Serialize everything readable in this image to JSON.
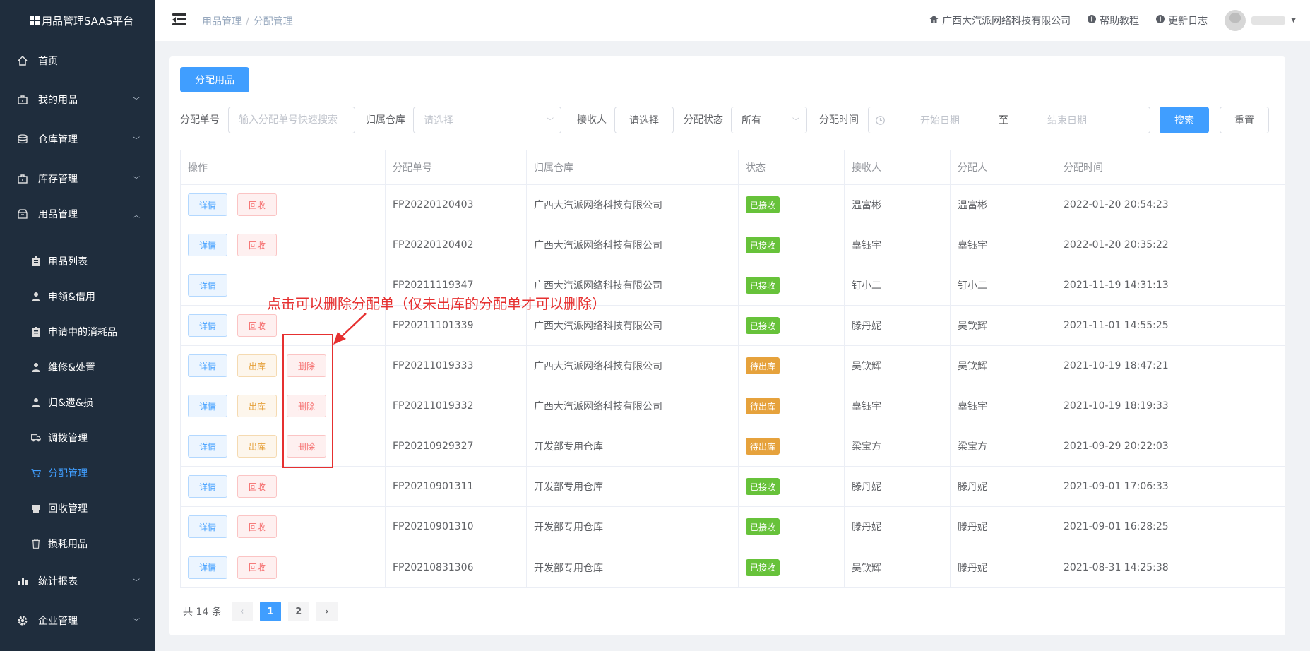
{
  "brand": {
    "title": "用品管理SAAS平台"
  },
  "sidebar": {
    "items": [
      {
        "label": "首页",
        "icon": "home-icon"
      },
      {
        "label": "我的用品",
        "icon": "bag-icon",
        "chevron": "down"
      },
      {
        "label": "仓库管理",
        "icon": "database-icon",
        "chevron": "down"
      },
      {
        "label": "库存管理",
        "icon": "bag-icon",
        "chevron": "down"
      },
      {
        "label": "用品管理",
        "icon": "box-icon",
        "chevron": "up"
      },
      {
        "label": "统计报表",
        "icon": "chart-icon",
        "chevron": "down"
      },
      {
        "label": "企业管理",
        "icon": "gear-icon",
        "chevron": "down"
      }
    ],
    "submenu": [
      {
        "label": "用品列表",
        "icon": "clipboard-icon"
      },
      {
        "label": "申领&借用",
        "icon": "user-icon"
      },
      {
        "label": "申请中的消耗品",
        "icon": "clipboard-icon"
      },
      {
        "label": "维修&处置",
        "icon": "user-icon"
      },
      {
        "label": "归&遗&损",
        "icon": "user-icon"
      },
      {
        "label": "调拨管理",
        "icon": "truck-icon"
      },
      {
        "label": "分配管理",
        "icon": "cart-icon",
        "active": true
      },
      {
        "label": "回收管理",
        "icon": "printer-icon"
      },
      {
        "label": "损耗用品",
        "icon": "trash-icon"
      }
    ]
  },
  "header": {
    "breadcrumb": [
      "用品管理",
      "分配管理"
    ],
    "company": "广西大汽派网络科技有限公司",
    "help": "帮助教程",
    "changelog": "更新日志"
  },
  "toolbar": {
    "assign_button": "分配用品"
  },
  "filters": {
    "no_label": "分配单号",
    "no_placeholder": "输入分配单号快速搜索",
    "warehouse_label": "归属仓库",
    "warehouse_placeholder": "请选择",
    "receiver_label": "接收人",
    "receiver_button": "请选择",
    "status_label": "分配状态",
    "status_value": "所有",
    "time_label": "分配时间",
    "start_placeholder": "开始日期",
    "range_sep": "至",
    "end_placeholder": "结束日期",
    "search_button": "搜索",
    "reset_button": "重置"
  },
  "table": {
    "columns": [
      "操作",
      "分配单号",
      "归属仓库",
      "状态",
      "接收人",
      "分配人",
      "分配时间"
    ],
    "rows": [
      {
        "actions": [
          "详情",
          "回收"
        ],
        "no": "FP20220120403",
        "warehouse": "广西大汽派网络科技有限公司",
        "status": "已接收",
        "receiver": "温富彬",
        "assigner": "温富彬",
        "time": "2022-01-20 20:54:23"
      },
      {
        "actions": [
          "详情",
          "回收"
        ],
        "no": "FP20220120402",
        "warehouse": "广西大汽派网络科技有限公司",
        "status": "已接收",
        "receiver": "辜钰宇",
        "assigner": "辜钰宇",
        "time": "2022-01-20 20:35:22"
      },
      {
        "actions": [
          "详情"
        ],
        "no": "FP20211119347",
        "warehouse": "广西大汽派网络科技有限公司",
        "status": "已接收",
        "receiver": "钉小二",
        "assigner": "钉小二",
        "time": "2021-11-19 14:31:13"
      },
      {
        "actions": [
          "详情",
          "回收"
        ],
        "no": "FP20211101339",
        "warehouse": "广西大汽派网络科技有限公司",
        "status": "已接收",
        "receiver": "滕丹妮",
        "assigner": "吴钦辉",
        "time": "2021-11-01 14:55:25"
      },
      {
        "actions": [
          "详情",
          "出库",
          "删除"
        ],
        "no": "FP20211019333",
        "warehouse": "广西大汽派网络科技有限公司",
        "status": "待出库",
        "receiver": "吴钦辉",
        "assigner": "吴钦辉",
        "time": "2021-10-19 18:47:21"
      },
      {
        "actions": [
          "详情",
          "出库",
          "删除"
        ],
        "no": "FP20211019332",
        "warehouse": "广西大汽派网络科技有限公司",
        "status": "待出库",
        "receiver": "辜钰宇",
        "assigner": "辜钰宇",
        "time": "2021-10-19 18:19:33"
      },
      {
        "actions": [
          "详情",
          "出库",
          "删除"
        ],
        "no": "FP20210929327",
        "warehouse": "开发部专用仓库",
        "status": "待出库",
        "receiver": "梁宝方",
        "assigner": "梁宝方",
        "time": "2021-09-29 20:22:03"
      },
      {
        "actions": [
          "详情",
          "回收"
        ],
        "no": "FP20210901311",
        "warehouse": "开发部专用仓库",
        "status": "已接收",
        "receiver": "滕丹妮",
        "assigner": "滕丹妮",
        "time": "2021-09-01 17:06:33"
      },
      {
        "actions": [
          "详情",
          "回收"
        ],
        "no": "FP20210901310",
        "warehouse": "开发部专用仓库",
        "status": "已接收",
        "receiver": "滕丹妮",
        "assigner": "滕丹妮",
        "time": "2021-09-01 16:28:25"
      },
      {
        "actions": [
          "详情",
          "回收"
        ],
        "no": "FP20210831306",
        "warehouse": "开发部专用仓库",
        "status": "已接收",
        "receiver": "吴钦辉",
        "assigner": "滕丹妮",
        "time": "2021-08-31 14:25:38"
      }
    ]
  },
  "pagination": {
    "total": "共 14 条",
    "pages": [
      "1",
      "2"
    ],
    "current": "1"
  },
  "annotation": {
    "text": "点击可以删除分配单（仅未出库的分配单才可以删除）"
  },
  "colors": {
    "primary": "#409eff",
    "success": "#67c23a",
    "warning": "#e6a23c",
    "danger": "#f56c6c",
    "sidebar": "#1f2d3d",
    "annotation": "#e63030"
  }
}
